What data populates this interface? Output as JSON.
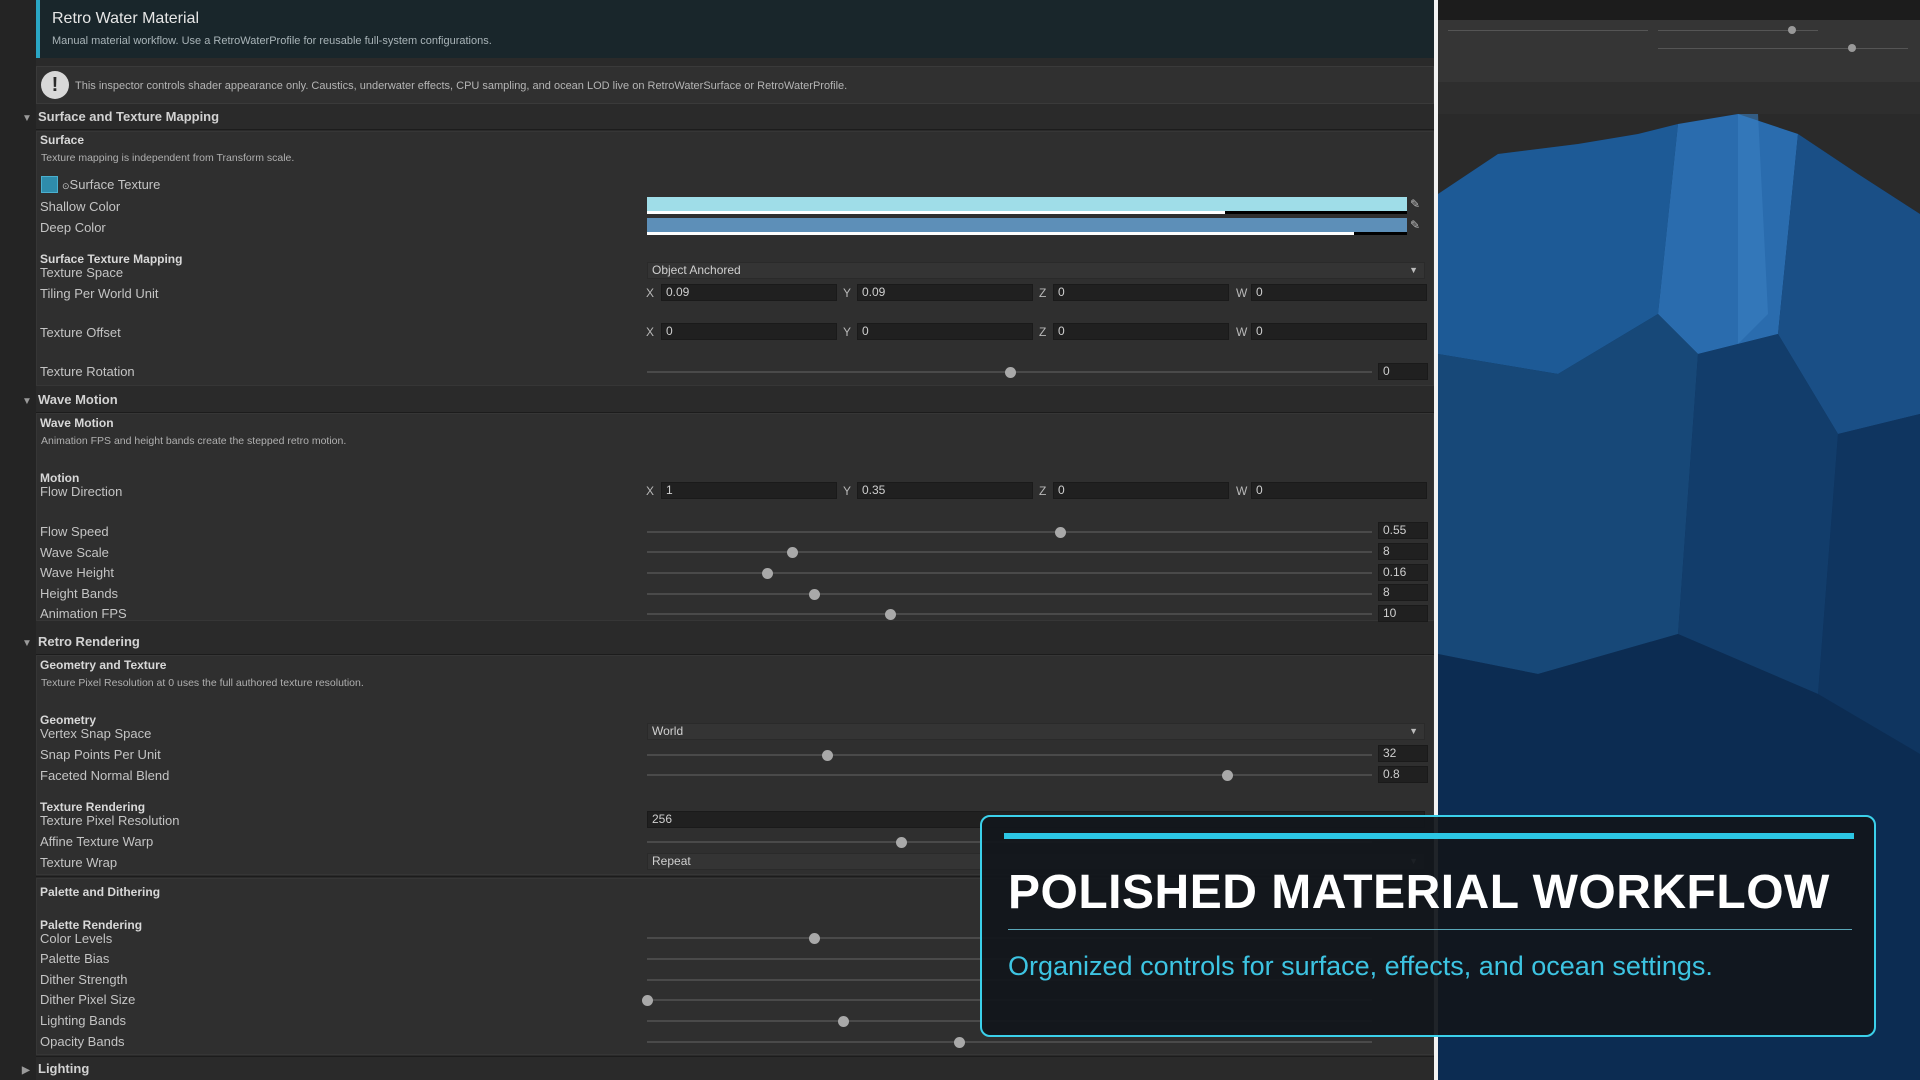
{
  "header": {
    "title": "Retro Water Material",
    "subtitle": "Manual material workflow. Use a RetroWaterProfile for reusable full-system configurations."
  },
  "help": {
    "text": "This inspector controls shader appearance only. Caustics, underwater effects, CPU sampling, and ocean LOD live on RetroWaterSurface or RetroWaterProfile."
  },
  "sections": {
    "surface": {
      "title": "Surface and Texture Mapping",
      "box_title": "Surface",
      "box_note": "Texture mapping is independent from Transform scale.",
      "surface_texture": "Surface Texture",
      "shallow_color": {
        "label": "Shallow Color",
        "color": "#9fdde8",
        "alpha": 0.76
      },
      "deep_color": {
        "label": "Deep Color",
        "color": "#5d8fb8",
        "alpha": 0.93
      },
      "mapping_group": "Surface Texture Mapping",
      "texture_space": {
        "label": "Texture Space",
        "value": "Object Anchored"
      },
      "tiling": {
        "label": "Tiling Per World Unit",
        "x": "0.09",
        "y": "0.09",
        "z": "0",
        "w": "0"
      },
      "offset": {
        "label": "Texture Offset",
        "x": "0",
        "y": "0",
        "z": "0",
        "w": "0"
      },
      "rotation": {
        "label": "Texture Rotation",
        "value": "0",
        "fraction": 0.5
      }
    },
    "wave": {
      "title": "Wave Motion",
      "box_title": "Wave Motion",
      "box_note": "Animation FPS and height bands create the stepped retro motion.",
      "motion_group": "Motion",
      "flow_direction": {
        "label": "Flow Direction",
        "x": "1",
        "y": "0.35",
        "z": "0",
        "w": "0"
      },
      "flow_speed": {
        "label": "Flow Speed",
        "value": "0.55",
        "fraction": 0.57
      },
      "wave_scale": {
        "label": "Wave Scale",
        "value": "8",
        "fraction": 0.2
      },
      "wave_height": {
        "label": "Wave Height",
        "value": "0.16",
        "fraction": 0.165
      },
      "height_bands": {
        "label": "Height Bands",
        "value": "8",
        "fraction": 0.23
      },
      "animation_fps": {
        "label": "Animation FPS",
        "value": "10",
        "fraction": 0.335
      }
    },
    "retro": {
      "title": "Retro Rendering",
      "box_title": "Geometry and Texture",
      "box_note": "Texture Pixel Resolution at 0 uses the full authored texture resolution.",
      "geometry_group": "Geometry",
      "vertex_snap_space": {
        "label": "Vertex Snap Space",
        "value": "World"
      },
      "snap_points": {
        "label": "Snap Points Per Unit",
        "value": "32",
        "fraction": 0.248
      },
      "faceted_blend": {
        "label": "Faceted Normal Blend",
        "value": "0.8",
        "fraction": 0.8
      },
      "texture_group": "Texture Rendering",
      "pixel_resolution": {
        "label": "Texture Pixel Resolution",
        "value": "256"
      },
      "affine_warp": {
        "label": "Affine Texture Warp",
        "fraction": 0.35
      },
      "texture_wrap": {
        "label": "Texture Wrap",
        "value": "Repeat"
      },
      "palette_box_title": "Palette and Dithering",
      "palette_group": "Palette Rendering",
      "color_levels": {
        "label": "Color Levels",
        "fraction": 0.23
      },
      "palette_bias": {
        "label": "Palette Bias"
      },
      "dither_strength": {
        "label": "Dither Strength"
      },
      "dither_pixel_size": {
        "label": "Dither Pixel Size",
        "fraction": 0.0
      },
      "lighting_bands": {
        "label": "Lighting Bands",
        "fraction": 0.27
      },
      "opacity_bands": {
        "label": "Opacity Bands",
        "fraction": 0.43
      }
    },
    "lighting": {
      "title": "Lighting"
    }
  },
  "overlay": {
    "headline": "POLISHED MATERIAL WORKFLOW",
    "tagline": "Organized controls for surface, effects, and ocean settings."
  },
  "colors": {
    "accent": "#2cc6e4",
    "water_dark": "#0f3a66",
    "water_light": "#2a6ab0"
  }
}
